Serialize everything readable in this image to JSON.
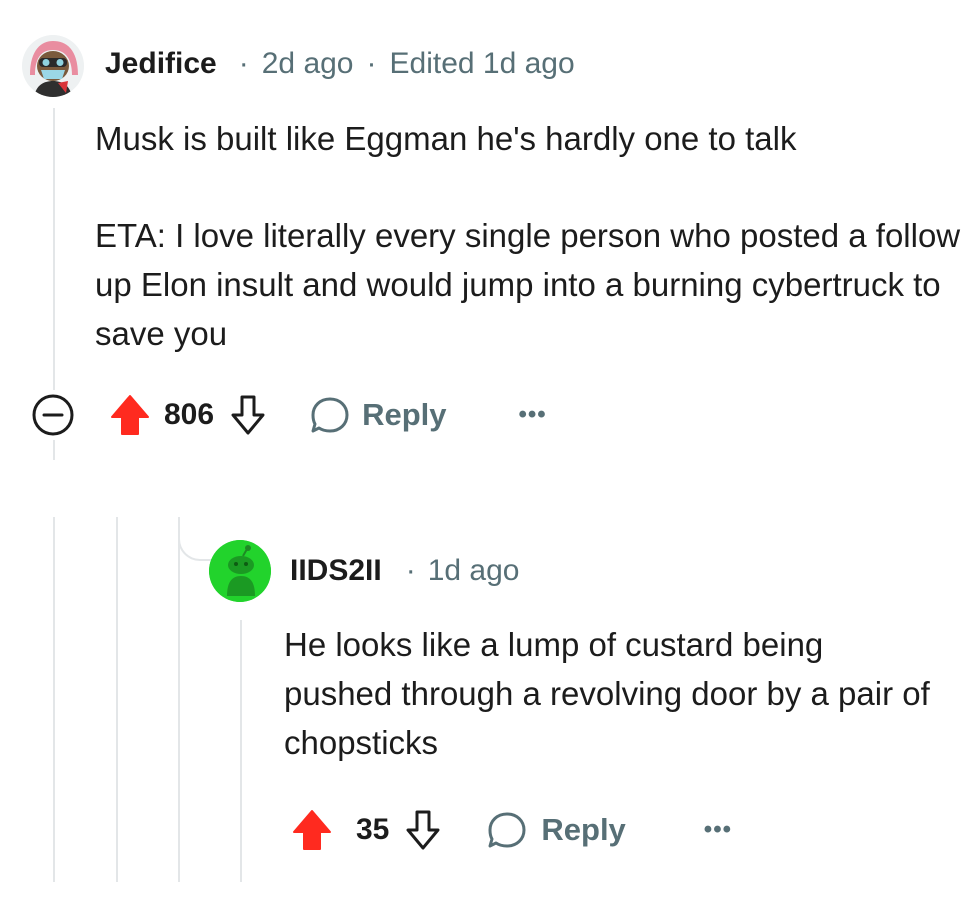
{
  "colors": {
    "upvote": "#ff2a1f",
    "meta": "#576f76",
    "thread_line": "#e3e6e8",
    "avatar_green": "#22d32c"
  },
  "comment": {
    "author": "Jedifice",
    "time": "2d ago",
    "edited": "Edited 1d ago",
    "body": [
      "Musk is built like Eggman he's hardly one to talk",
      "ETA: I love literally every single person who posted a follow up Elon insult and would jump into a burning cybertruck to save you"
    ],
    "score": "806",
    "reply_label": "Reply",
    "more_label": "•••",
    "icons": [
      "collapse-minus-icon",
      "upvote-arrow-icon",
      "downvote-arrow-icon",
      "reply-bubble-icon",
      "more-dots-icon"
    ]
  },
  "reply": {
    "author": "IIDS2II",
    "time": "1d ago",
    "body": [
      "He looks like a lump of custard being pushed through a revolving door by a pair of chopsticks"
    ],
    "score": "35",
    "reply_label": "Reply",
    "more_label": "•••",
    "icons": [
      "upvote-arrow-icon",
      "downvote-arrow-icon",
      "reply-bubble-icon",
      "more-dots-icon"
    ]
  },
  "separator": "·"
}
